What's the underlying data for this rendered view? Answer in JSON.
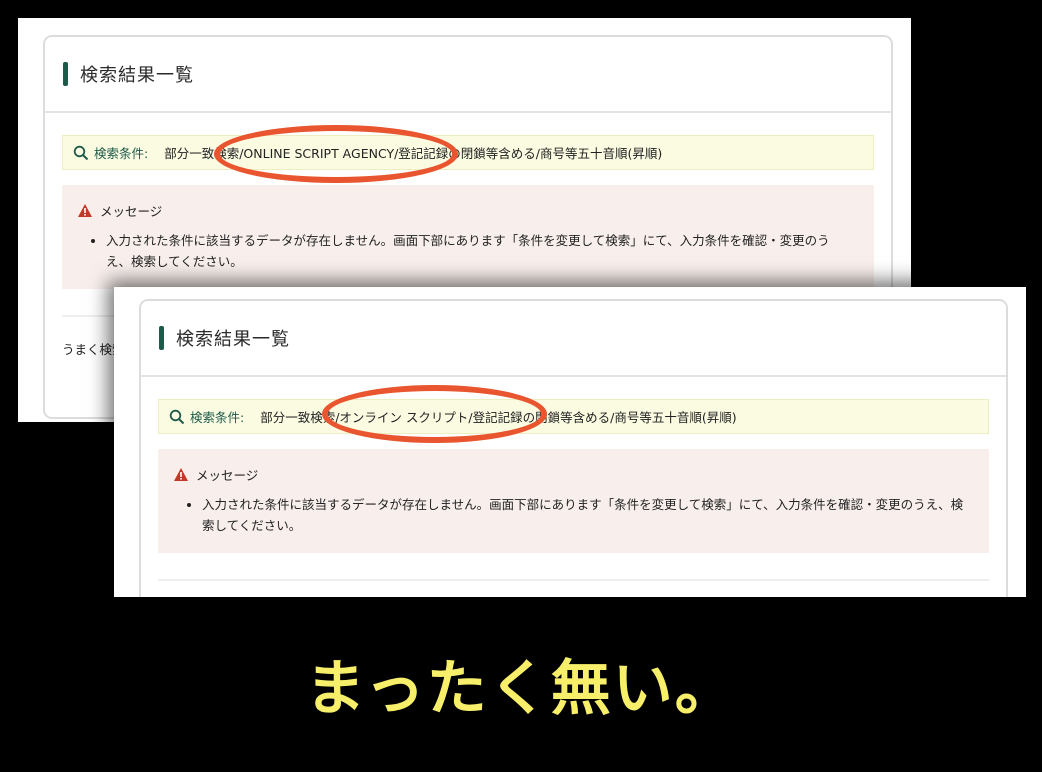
{
  "back_screen": {
    "title": "検索結果一覧",
    "condition_label": "検索条件:",
    "condition_text": "部分一致検索/ONLINE SCRIPT AGENCY/登記記録の閉鎖等含める/商号等五十音順(昇順)",
    "message_heading": "メッセージ",
    "message_item": "入力された条件に該当するデータが存在しません。画面下部にあります「条件を変更して検索」にて、入力条件を確認・変更のうえ、検索してください。",
    "hint_text": "うまく検索"
  },
  "front_screen": {
    "title": "検索結果一覧",
    "condition_label": "検索条件:",
    "condition_text": "部分一致検索/オンライン スクリプト/登記記録の閉鎖等含める/商号等五十音順(昇順)",
    "message_heading": "メッセージ",
    "message_item": "入力された条件に該当するデータが存在しません。画面下部にあります「条件を変更して検索」にて、入力条件を確認・変更のうえ、検索してください。"
  },
  "caption": "まったく無い。",
  "colors": {
    "accent_green": "#1e5a4a",
    "highlight_circle": "#e8552e",
    "caption_yellow": "#f7ef6a",
    "condition_bg": "#fbfbe2",
    "message_bg": "#f8efec"
  },
  "icons": [
    "search-icon",
    "warning-icon"
  ]
}
